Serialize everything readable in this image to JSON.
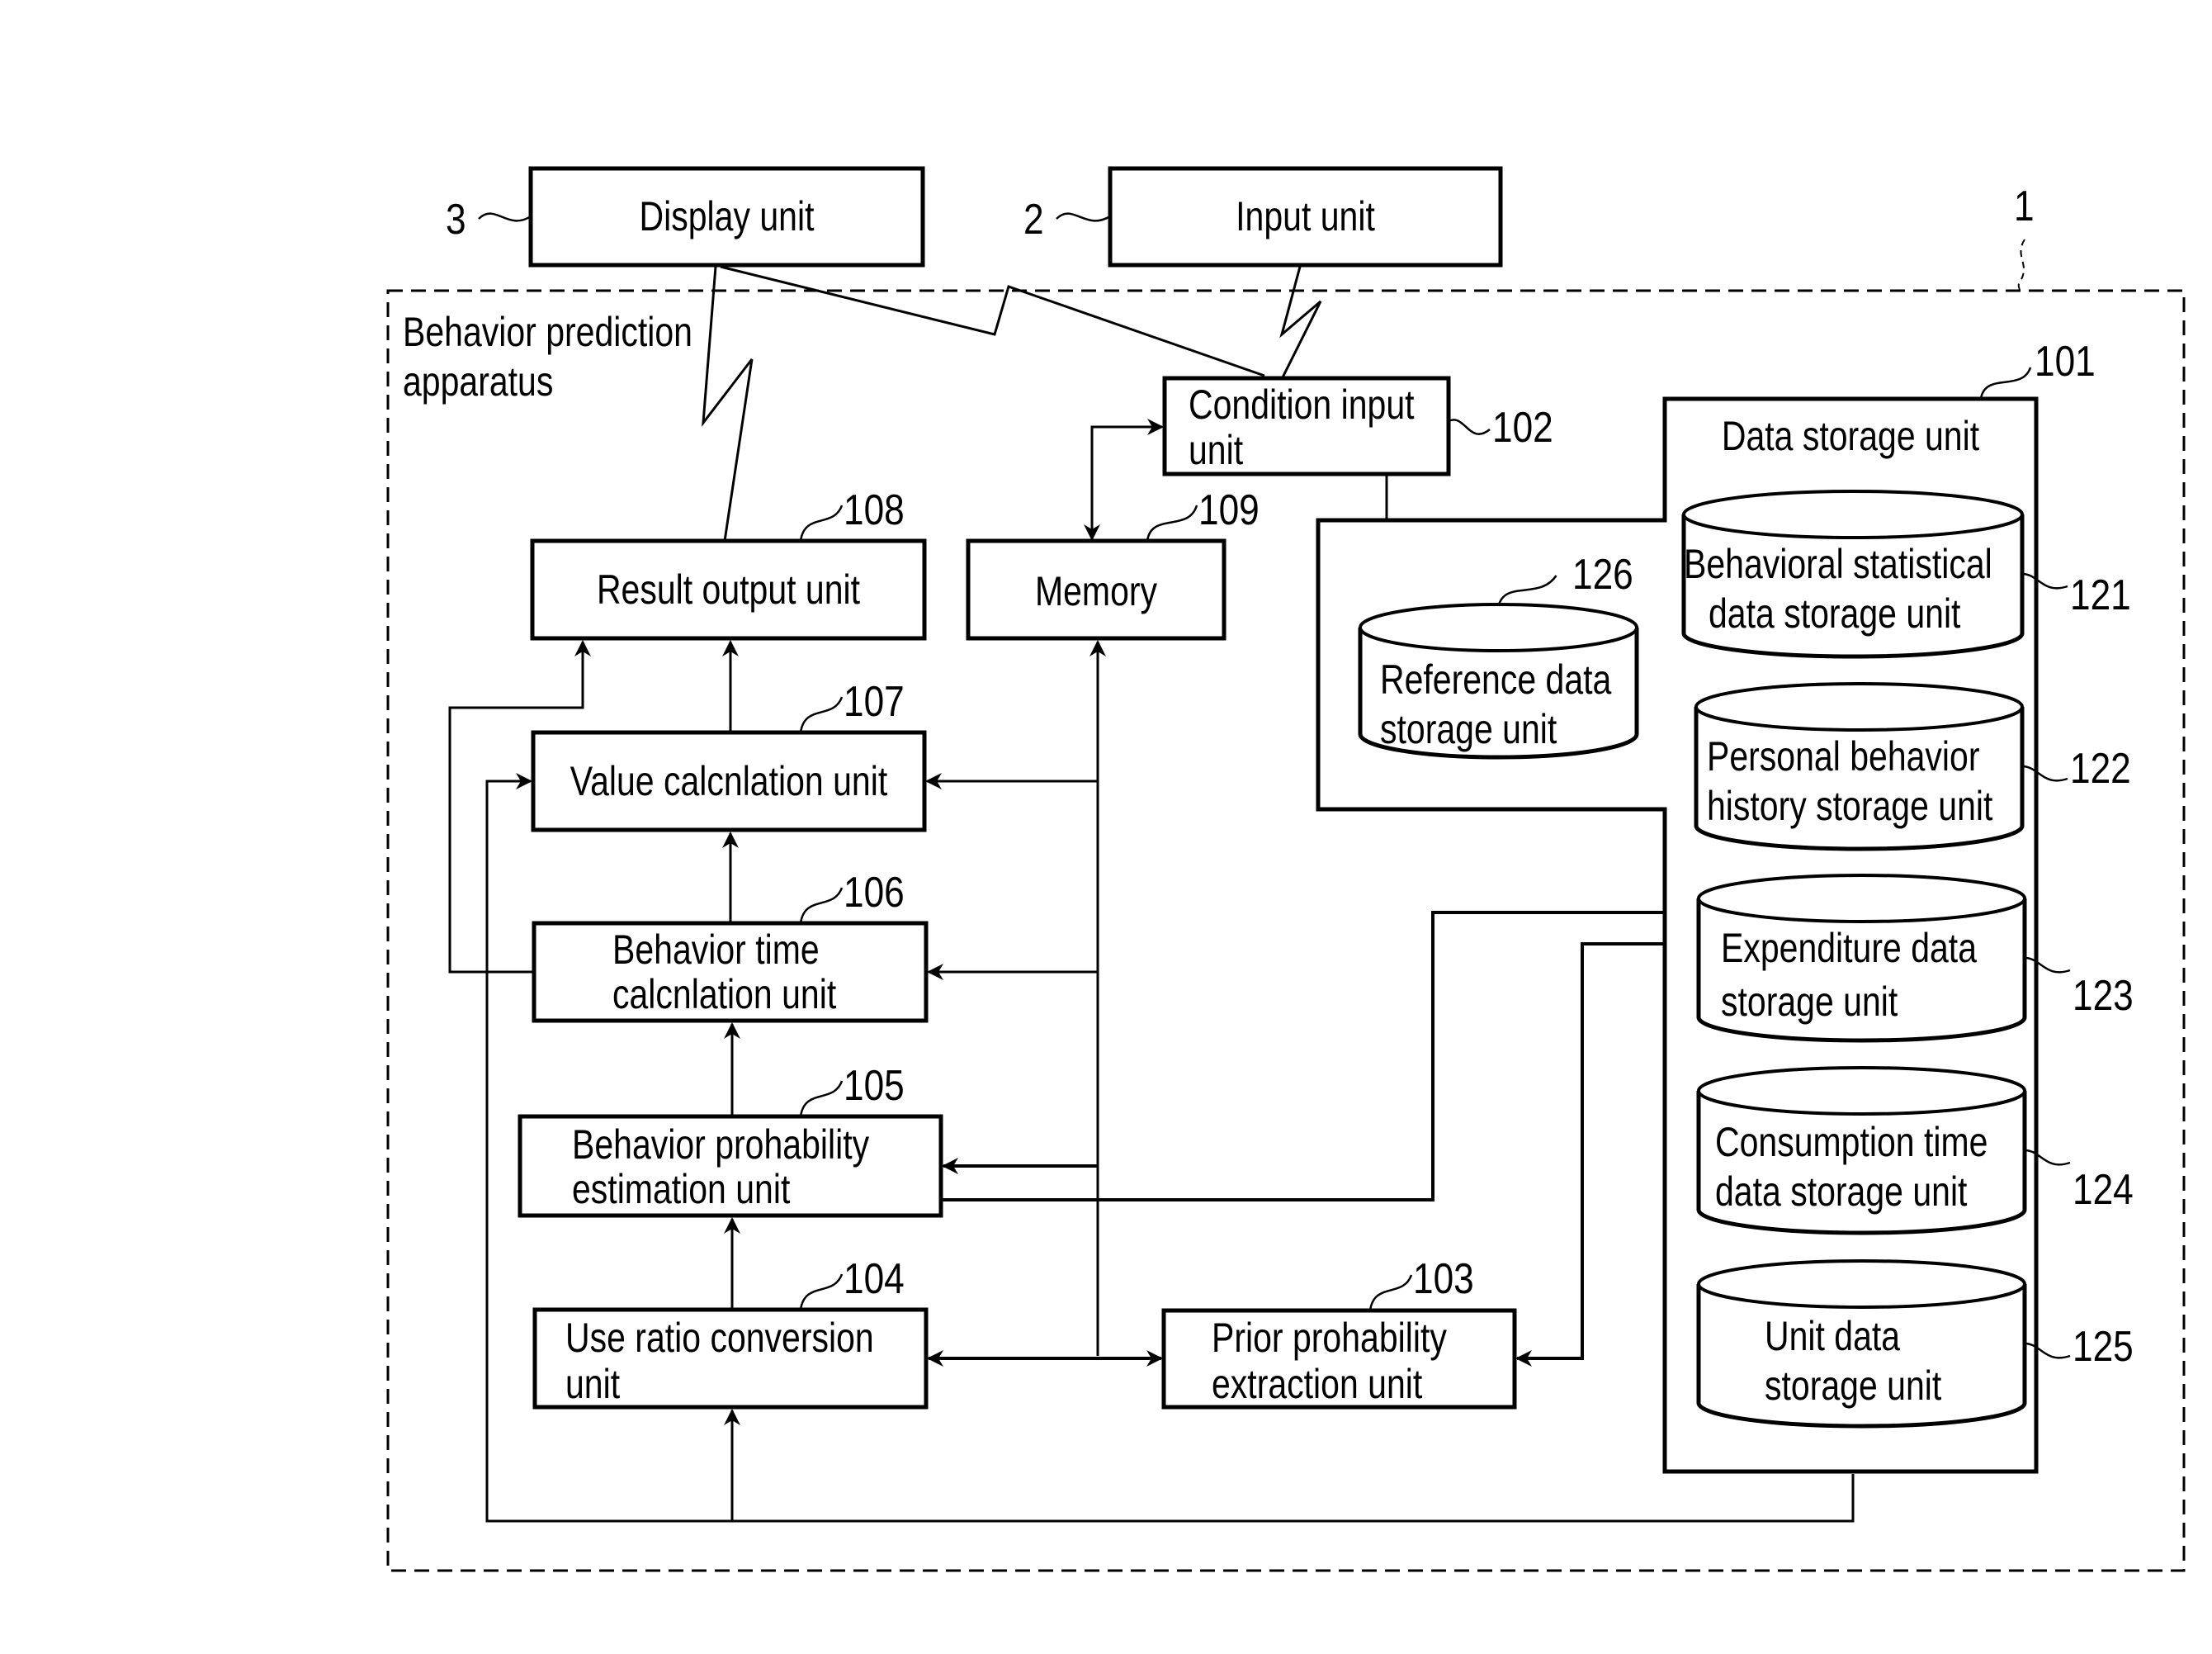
{
  "figure": {
    "apparatus": {
      "label": "Behavior prediction apparatus",
      "line1": "Behavior prediction",
      "line2": "apparatus",
      "ref": "1"
    },
    "external": {
      "display": {
        "label": "Display unit",
        "ref": "3"
      },
      "input": {
        "label": "Input unit",
        "ref": "2"
      }
    },
    "units": {
      "condition_input": {
        "line1": "Condition input",
        "line2": "unit",
        "ref": "102"
      },
      "result_output": {
        "label": "Result output unit",
        "ref": "108"
      },
      "memory": {
        "label": "Memory",
        "ref": "109"
      },
      "value_calc": {
        "label": "Value calcnlation unit",
        "ref": "107"
      },
      "behavior_time": {
        "line1": "Behavior time",
        "line2": "calcnlation unit",
        "ref": "106"
      },
      "behavior_prob": {
        "line1": "Behavior prohability",
        "line2": "estimation unit",
        "ref": "105"
      },
      "use_ratio": {
        "line1": "Use ratio conversion",
        "line2": "unit",
        "ref": "104"
      },
      "prior_prob": {
        "line1": "Prior prohability",
        "line2": "extraction unit",
        "ref": "103"
      }
    },
    "data_storage": {
      "label": "Data storage unit",
      "ref": "101",
      "stores": [
        {
          "line1": "Behavioral statistical",
          "line2": "data storage unit",
          "ref": "121"
        },
        {
          "line1": "Personal behavior",
          "line2": "history storage unit",
          "ref": "122"
        },
        {
          "line1": "Expenditure data",
          "line2": "storage unit",
          "ref": "123"
        },
        {
          "line1": "Consumption time",
          "line2": "data storage unit",
          "ref": "124"
        },
        {
          "line1": "Unit data",
          "line2": "storage unit",
          "ref": "125"
        }
      ],
      "reference": {
        "line1": "Reference data",
        "line2": "storage unit",
        "ref": "126"
      }
    }
  }
}
